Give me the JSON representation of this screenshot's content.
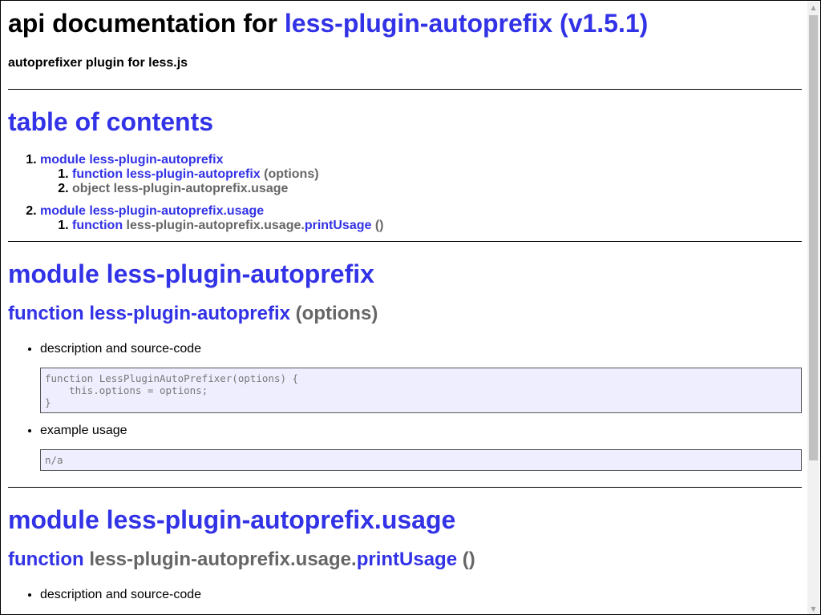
{
  "header": {
    "title_prefix": "api documentation for ",
    "title_link": "less-plugin-autoprefix (v1.5.1)",
    "subtitle": "autoprefixer plugin for less.js"
  },
  "toc": {
    "title": "table of contents",
    "items": [
      {
        "number": "1.",
        "label": "module less-plugin-autoprefix",
        "children": [
          {
            "number": "1.",
            "kind": "function",
            "name": "less-plugin-autoprefix",
            "args": "(options)"
          },
          {
            "number": "2.",
            "kind": "object",
            "name": "less-plugin-autoprefix.usage"
          }
        ]
      },
      {
        "number": "2.",
        "label": "module less-plugin-autoprefix.usage",
        "children": [
          {
            "number": "1.",
            "kind": "function",
            "prefix": "less-plugin-autoprefix.usage.",
            "name": "printUsage",
            "args": "()"
          }
        ]
      }
    ]
  },
  "module1": {
    "title": "module less-plugin-autoprefix",
    "func": {
      "kind": "function",
      "name": "less-plugin-autoprefix",
      "args": "(options)",
      "desc_label": "description and source-code",
      "source": "function LessPluginAutoPrefixer(options) {\n    this.options = options;\n}",
      "example_label": "example usage",
      "example": "n/a"
    }
  },
  "module2": {
    "title": "module less-plugin-autoprefix.usage",
    "func": {
      "kind": "function",
      "prefix": "less-plugin-autoprefix.usage.",
      "name": "printUsage",
      "args": "()",
      "desc_label": "description and source-code"
    }
  },
  "scrollbar": {
    "up_icon": "▲",
    "down_icon": "▼"
  }
}
